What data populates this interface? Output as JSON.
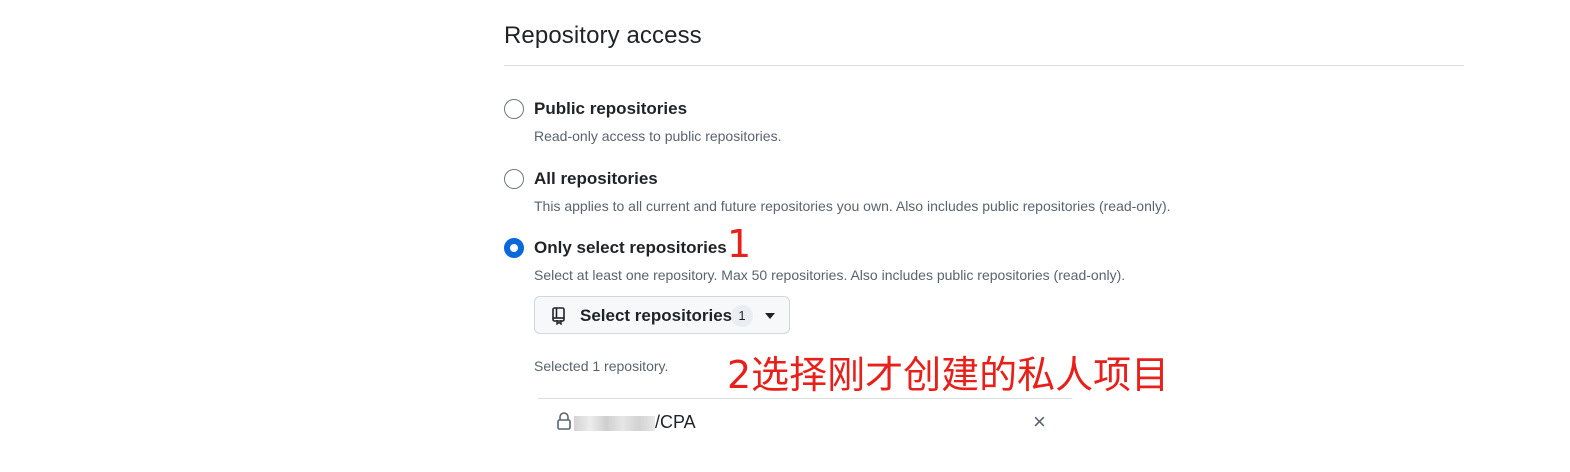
{
  "section": {
    "title": "Repository access"
  },
  "options": [
    {
      "label": "Public repositories",
      "description": "Read-only access to public repositories.",
      "checked": false
    },
    {
      "label": "All repositories",
      "description": "This applies to all current and future repositories you own. Also includes public repositories (read-only).",
      "checked": false
    },
    {
      "label": "Only select repositories",
      "description": "Select at least one repository. Max 50 repositories. Also includes public repositories (read-only).",
      "checked": true
    }
  ],
  "select_button": {
    "label": "Select repositories",
    "count": "1",
    "icon": "repo-icon"
  },
  "selected_summary": "Selected 1 repository.",
  "selected_repos": [
    {
      "name": "/CPA",
      "icon": "lock-icon",
      "remove_symbol": "×"
    }
  ],
  "annotations": {
    "step1": "1",
    "step2": "2选择刚才创建的私人项目"
  },
  "colors": {
    "accent": "#0969da",
    "annotation": "#e8201b",
    "muted_text": "#59636e"
  }
}
